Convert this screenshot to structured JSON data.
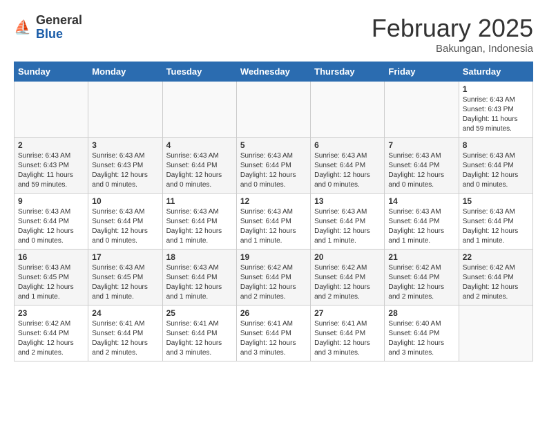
{
  "header": {
    "logo_general": "General",
    "logo_blue": "Blue",
    "month_title": "February 2025",
    "location": "Bakungan, Indonesia"
  },
  "days_of_week": [
    "Sunday",
    "Monday",
    "Tuesday",
    "Wednesday",
    "Thursday",
    "Friday",
    "Saturday"
  ],
  "weeks": [
    [
      {
        "day": "",
        "info": ""
      },
      {
        "day": "",
        "info": ""
      },
      {
        "day": "",
        "info": ""
      },
      {
        "day": "",
        "info": ""
      },
      {
        "day": "",
        "info": ""
      },
      {
        "day": "",
        "info": ""
      },
      {
        "day": "1",
        "info": "Sunrise: 6:43 AM\nSunset: 6:43 PM\nDaylight: 11 hours\nand 59 minutes."
      }
    ],
    [
      {
        "day": "2",
        "info": "Sunrise: 6:43 AM\nSunset: 6:43 PM\nDaylight: 11 hours\nand 59 minutes."
      },
      {
        "day": "3",
        "info": "Sunrise: 6:43 AM\nSunset: 6:43 PM\nDaylight: 12 hours\nand 0 minutes."
      },
      {
        "day": "4",
        "info": "Sunrise: 6:43 AM\nSunset: 6:44 PM\nDaylight: 12 hours\nand 0 minutes."
      },
      {
        "day": "5",
        "info": "Sunrise: 6:43 AM\nSunset: 6:44 PM\nDaylight: 12 hours\nand 0 minutes."
      },
      {
        "day": "6",
        "info": "Sunrise: 6:43 AM\nSunset: 6:44 PM\nDaylight: 12 hours\nand 0 minutes."
      },
      {
        "day": "7",
        "info": "Sunrise: 6:43 AM\nSunset: 6:44 PM\nDaylight: 12 hours\nand 0 minutes."
      },
      {
        "day": "8",
        "info": "Sunrise: 6:43 AM\nSunset: 6:44 PM\nDaylight: 12 hours\nand 0 minutes."
      }
    ],
    [
      {
        "day": "9",
        "info": "Sunrise: 6:43 AM\nSunset: 6:44 PM\nDaylight: 12 hours\nand 0 minutes."
      },
      {
        "day": "10",
        "info": "Sunrise: 6:43 AM\nSunset: 6:44 PM\nDaylight: 12 hours\nand 0 minutes."
      },
      {
        "day": "11",
        "info": "Sunrise: 6:43 AM\nSunset: 6:44 PM\nDaylight: 12 hours\nand 1 minute."
      },
      {
        "day": "12",
        "info": "Sunrise: 6:43 AM\nSunset: 6:44 PM\nDaylight: 12 hours\nand 1 minute."
      },
      {
        "day": "13",
        "info": "Sunrise: 6:43 AM\nSunset: 6:44 PM\nDaylight: 12 hours\nand 1 minute."
      },
      {
        "day": "14",
        "info": "Sunrise: 6:43 AM\nSunset: 6:44 PM\nDaylight: 12 hours\nand 1 minute."
      },
      {
        "day": "15",
        "info": "Sunrise: 6:43 AM\nSunset: 6:44 PM\nDaylight: 12 hours\nand 1 minute."
      }
    ],
    [
      {
        "day": "16",
        "info": "Sunrise: 6:43 AM\nSunset: 6:45 PM\nDaylight: 12 hours\nand 1 minute."
      },
      {
        "day": "17",
        "info": "Sunrise: 6:43 AM\nSunset: 6:45 PM\nDaylight: 12 hours\nand 1 minute."
      },
      {
        "day": "18",
        "info": "Sunrise: 6:43 AM\nSunset: 6:44 PM\nDaylight: 12 hours\nand 1 minute."
      },
      {
        "day": "19",
        "info": "Sunrise: 6:42 AM\nSunset: 6:44 PM\nDaylight: 12 hours\nand 2 minutes."
      },
      {
        "day": "20",
        "info": "Sunrise: 6:42 AM\nSunset: 6:44 PM\nDaylight: 12 hours\nand 2 minutes."
      },
      {
        "day": "21",
        "info": "Sunrise: 6:42 AM\nSunset: 6:44 PM\nDaylight: 12 hours\nand 2 minutes."
      },
      {
        "day": "22",
        "info": "Sunrise: 6:42 AM\nSunset: 6:44 PM\nDaylight: 12 hours\nand 2 minutes."
      }
    ],
    [
      {
        "day": "23",
        "info": "Sunrise: 6:42 AM\nSunset: 6:44 PM\nDaylight: 12 hours\nand 2 minutes."
      },
      {
        "day": "24",
        "info": "Sunrise: 6:41 AM\nSunset: 6:44 PM\nDaylight: 12 hours\nand 2 minutes."
      },
      {
        "day": "25",
        "info": "Sunrise: 6:41 AM\nSunset: 6:44 PM\nDaylight: 12 hours\nand 3 minutes."
      },
      {
        "day": "26",
        "info": "Sunrise: 6:41 AM\nSunset: 6:44 PM\nDaylight: 12 hours\nand 3 minutes."
      },
      {
        "day": "27",
        "info": "Sunrise: 6:41 AM\nSunset: 6:44 PM\nDaylight: 12 hours\nand 3 minutes."
      },
      {
        "day": "28",
        "info": "Sunrise: 6:40 AM\nSunset: 6:44 PM\nDaylight: 12 hours\nand 3 minutes."
      },
      {
        "day": "",
        "info": ""
      }
    ]
  ]
}
